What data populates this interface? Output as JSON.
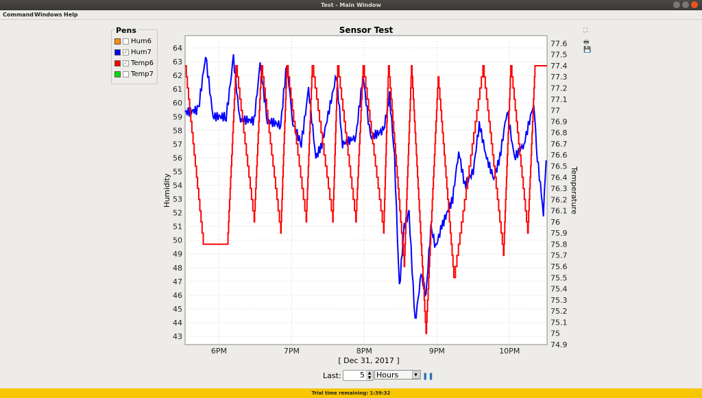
{
  "window": {
    "title": "Test - Main Window"
  },
  "menu": [
    "Command",
    "Windows",
    "Help"
  ],
  "pens": {
    "title": "Pens",
    "items": [
      {
        "label": "Hum6",
        "color": "#ff8c00",
        "checked": false
      },
      {
        "label": "Hum7",
        "color": "#0000ff",
        "checked": true
      },
      {
        "label": "Temp6",
        "color": "#ff0000",
        "checked": true
      },
      {
        "label": "Temp7",
        "color": "#00e000",
        "checked": false
      }
    ]
  },
  "toolbar_icons": [
    "fit-icon",
    "print-icon",
    "save-icon"
  ],
  "controls": {
    "last_label": "Last:",
    "last_value": "5",
    "unit": "Hours"
  },
  "status": "Trial time remaining: 1:39:32",
  "chart_data": {
    "type": "line",
    "title": "Sensor Test",
    "xlabel": "[ Dec 31, 2017 ]",
    "ylabel": "Humidity",
    "y2label": "Temperature",
    "xlim": [
      "17:32",
      "22:31"
    ],
    "xticks": [
      "6PM",
      "7PM",
      "8PM",
      "9PM",
      "10PM"
    ],
    "xtick_times": [
      "18:00",
      "19:00",
      "20:00",
      "21:00",
      "22:00"
    ],
    "ylim": [
      42.4,
      64.9
    ],
    "yticks": [
      43,
      44,
      45,
      46,
      47,
      48,
      49,
      50,
      51,
      52,
      53,
      54,
      55,
      56,
      57,
      58,
      59,
      60,
      61,
      62,
      63,
      64
    ],
    "y2lim": [
      74.9,
      77.67
    ],
    "y2ticks": [
      "74.9",
      "75",
      "75.1",
      "75.2",
      "75.3",
      "75.4",
      "75.5",
      "75.6",
      "75.7",
      "75.8",
      "75.9",
      "76",
      "76.1",
      "76.2",
      "76.3",
      "76.4",
      "76.5",
      "76.6",
      "76.7",
      "76.8",
      "76.9",
      "77",
      "77.1",
      "77.2",
      "77.3",
      "77.4",
      "77.5",
      "77.6"
    ],
    "grid": true,
    "series": [
      {
        "name": "Hum7",
        "axis": "left",
        "color": "#0000ff",
        "points": [
          [
            "17:32",
            59.3
          ],
          [
            "17:43",
            59.5
          ],
          [
            "17:49",
            63.5
          ],
          [
            "17:55",
            59
          ],
          [
            "18:06",
            59
          ],
          [
            "18:12",
            63.3
          ],
          [
            "18:17",
            58.8
          ],
          [
            "18:29",
            58.7
          ],
          [
            "18:34",
            62.8
          ],
          [
            "18:40",
            58.7
          ],
          [
            "18:51",
            58.4
          ],
          [
            "18:56",
            63
          ],
          [
            "19:01",
            58.5
          ],
          [
            "19:08",
            57
          ],
          [
            "19:14",
            61
          ],
          [
            "19:20",
            56
          ],
          [
            "19:25",
            57
          ],
          [
            "19:37",
            62
          ],
          [
            "19:42",
            57
          ],
          [
            "19:53",
            57.5
          ],
          [
            "19:59",
            62
          ],
          [
            "20:05",
            57.5
          ],
          [
            "20:16",
            58
          ],
          [
            "20:21",
            60.5
          ],
          [
            "20:25",
            56
          ],
          [
            "20:29",
            46.5
          ],
          [
            "20:33",
            51
          ],
          [
            "20:37",
            52
          ],
          [
            "20:42",
            44
          ],
          [
            "20:47",
            47.5
          ],
          [
            "20:51",
            46
          ],
          [
            "20:55",
            51
          ],
          [
            "20:59",
            49.5
          ],
          [
            "21:04",
            51
          ],
          [
            "21:13",
            53
          ],
          [
            "21:18",
            56.5
          ],
          [
            "21:23",
            54
          ],
          [
            "21:30",
            55
          ],
          [
            "21:35",
            58.5
          ],
          [
            "21:41",
            56
          ],
          [
            "21:47",
            54.5
          ],
          [
            "21:52",
            56
          ],
          [
            "21:58",
            59.5
          ],
          [
            "22:04",
            56
          ],
          [
            "22:12",
            57
          ],
          [
            "22:20",
            60
          ],
          [
            "22:23",
            56
          ],
          [
            "22:28",
            52
          ],
          [
            "22:31",
            57.3
          ]
        ]
      },
      {
        "name": "Temp6",
        "axis": "right",
        "color": "#ff0000",
        "points": [
          [
            "17:32",
            77.4
          ],
          [
            "17:47",
            75.8
          ],
          [
            "18:07",
            75.8
          ],
          [
            "18:14",
            77.4
          ],
          [
            "18:29",
            76.0
          ],
          [
            "18:35",
            77.4
          ],
          [
            "18:51",
            75.9
          ],
          [
            "18:56",
            77.4
          ],
          [
            "19:12",
            76.0
          ],
          [
            "19:17",
            77.4
          ],
          [
            "19:34",
            76.0
          ],
          [
            "19:38",
            77.4
          ],
          [
            "19:53",
            76.0
          ],
          [
            "19:59",
            77.4
          ],
          [
            "20:16",
            75.9
          ],
          [
            "20:20",
            77.4
          ],
          [
            "20:33",
            75.6
          ],
          [
            "20:39",
            77.4
          ],
          [
            "20:51",
            75.0
          ],
          [
            "21:01",
            77.3
          ],
          [
            "21:14",
            75.5
          ],
          [
            "21:38",
            77.4
          ],
          [
            "21:55",
            75.7
          ],
          [
            "22:01",
            77.4
          ],
          [
            "22:15",
            75.9
          ],
          [
            "22:21",
            77.4
          ],
          [
            "22:31",
            77.4
          ]
        ]
      }
    ]
  }
}
